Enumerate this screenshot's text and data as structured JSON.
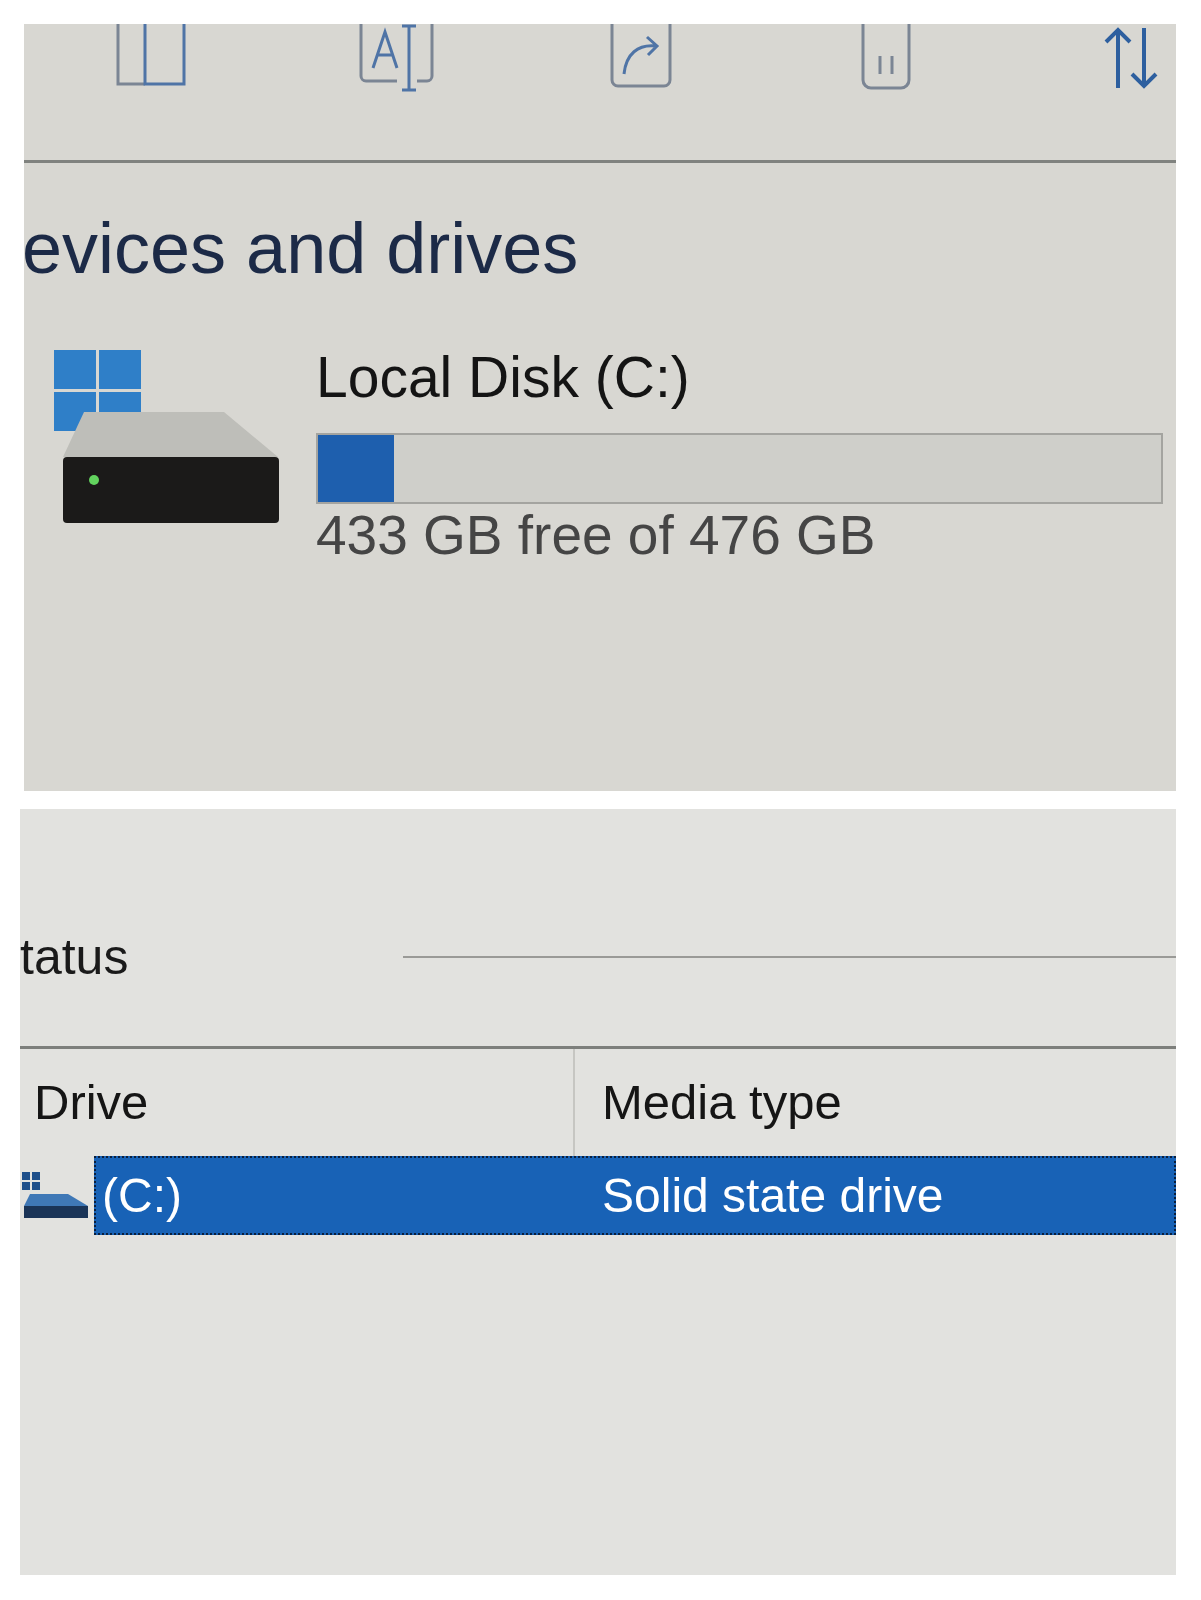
{
  "top_panel": {
    "heading": "evices and drives",
    "drive": {
      "name": "Local Disk (C:)",
      "level": 0.09,
      "free_space": "433 GB free of 476 GB"
    }
  },
  "bottom_panel": {
    "heading": "tatus",
    "table": {
      "columns": [
        "Drive",
        "Media type"
      ],
      "rows": [
        {
          "selected": true,
          "cells": [
            "(C:)",
            "Solid state drive"
          ]
        }
      ]
    }
  }
}
